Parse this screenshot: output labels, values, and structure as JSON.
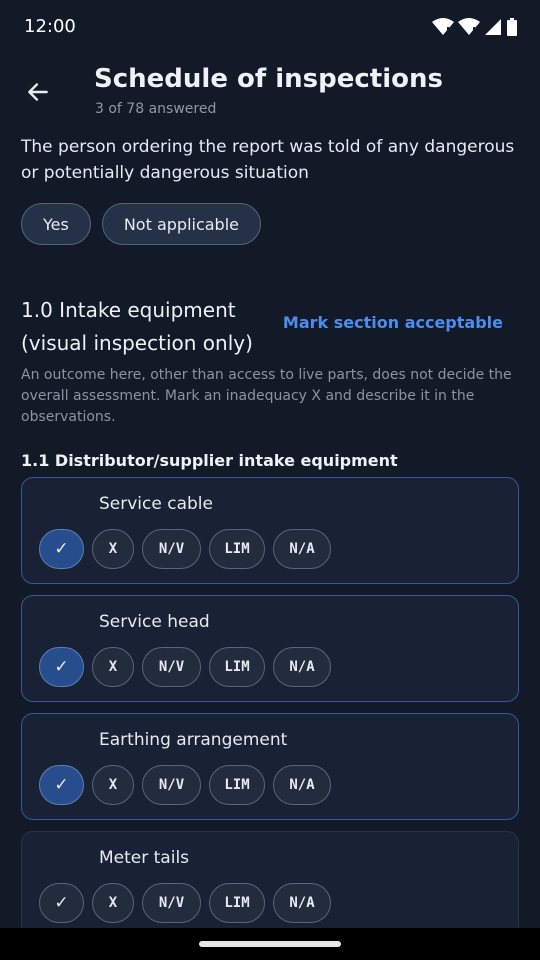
{
  "status": {
    "time": "12:00"
  },
  "header": {
    "title": "Schedule of inspections",
    "subtitle": "3 of 78 answered"
  },
  "question": {
    "text": "The person ordering the report was told of any dangerous or potentially dangerous situation",
    "options": [
      "Yes",
      "Not applicable"
    ]
  },
  "section": {
    "title": "1.0  Intake equipment (visual inspection only)",
    "action_label": "Mark section acceptable",
    "description": "An outcome here, other than access to live parts, does not decide the overall assessment. Mark an inadequacy X and describe it in the observations."
  },
  "subsection": {
    "title": "1.1  Distributor/supplier intake equipment"
  },
  "options_labels": [
    "✓",
    "X",
    "N/V",
    "LIM",
    "N/A"
  ],
  "items": [
    {
      "title": "Service cable",
      "selected": "✓"
    },
    {
      "title": "Service head",
      "selected": "✓"
    },
    {
      "title": "Earthing arrangement",
      "selected": "✓"
    },
    {
      "title": "Meter tails",
      "selected": ""
    }
  ],
  "colors": {
    "background": "#121a27",
    "accent": "#4d8df0",
    "selected_option": "#284d8c",
    "card_border": "#32599a"
  }
}
